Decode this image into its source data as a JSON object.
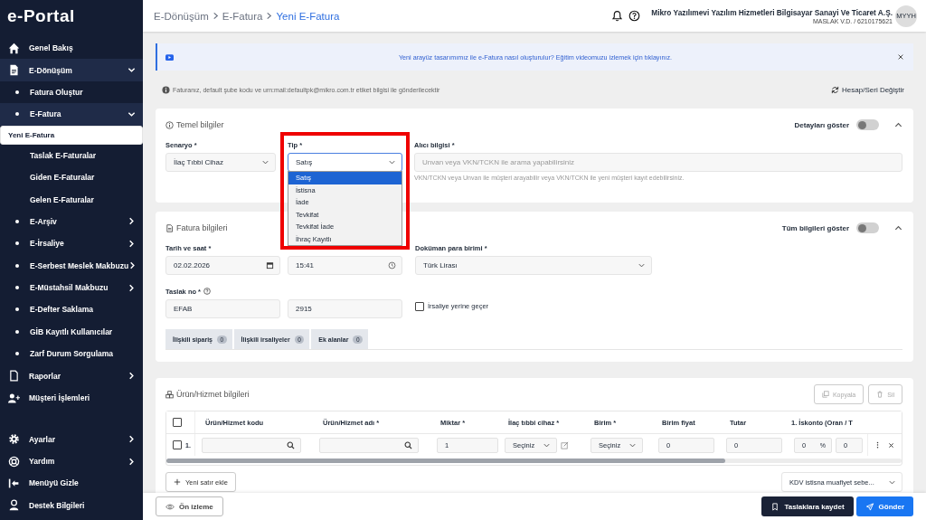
{
  "sidebar": {
    "logo": "e-Portal",
    "items": [
      {
        "label": "Genel Bakış",
        "kind": "link",
        "selected": false
      },
      {
        "label": "E-Dönüşüm",
        "kind": "group",
        "expanded": true,
        "selected": false,
        "children": [
          {
            "label": "Fatura Oluştur",
            "kind": "link",
            "selected": false
          },
          {
            "label": "E-Fatura",
            "kind": "group",
            "expanded": true,
            "selected": false,
            "children": [
              {
                "label": "Yeni E-Fatura",
                "selected": true
              },
              {
                "label": "Taslak E-Faturalar",
                "selected": false
              },
              {
                "label": "Giden E-Faturalar",
                "selected": false
              },
              {
                "label": "Gelen E-Faturalar",
                "selected": false
              }
            ]
          },
          {
            "label": "E-Arşiv",
            "kind": "group",
            "expanded": false,
            "selected": false
          },
          {
            "label": "E-İrsaliye",
            "kind": "group",
            "expanded": false,
            "selected": false
          },
          {
            "label": "E-Serbest Meslek Makbuzu",
            "kind": "group",
            "expanded": false,
            "selected": false
          },
          {
            "label": "E-Müstahsil Makbuzu",
            "kind": "group",
            "expanded": false,
            "selected": false
          },
          {
            "label": "E-Defter Saklama",
            "kind": "link",
            "selected": false
          },
          {
            "label": "GİB Kayıtlı Kullanıcılar",
            "kind": "link",
            "selected": false
          },
          {
            "label": "Zarf Durum Sorgulama",
            "kind": "link",
            "selected": false
          }
        ]
      },
      {
        "label": "Raporlar",
        "kind": "group",
        "expanded": false,
        "selected": false
      },
      {
        "label": "Müşteri İşlemleri",
        "kind": "link",
        "selected": false
      }
    ],
    "footer_items": [
      {
        "label": "Ayarlar",
        "kind": "group",
        "expanded": false,
        "selected": false
      },
      {
        "label": "Yardım",
        "kind": "group",
        "expanded": false,
        "selected": false
      },
      {
        "label": "Menüyü Gizle",
        "kind": "link",
        "selected": false
      },
      {
        "label": "Destek Bilgileri",
        "kind": "link",
        "selected": false
      }
    ]
  },
  "header": {
    "breadcrumb": [
      {
        "label": "E-Dönüşüm",
        "current": false
      },
      {
        "label": "E-Fatura",
        "current": false
      },
      {
        "label": "Yeni E-Fatura",
        "current": true
      }
    ],
    "company": "Mikro Yazılımevi Yazılım Hizmetleri Bilgisayar Sanayi Ve Ticaret A.Ş.",
    "tax_info": "MASLAK V.D. / 6210175621",
    "avatar": "MYYH"
  },
  "banner": {
    "text": "Yeni arayüz tasarımımız ile e-Fatura nasıl oluşturulur? Eğitim videomuzu izlemek için tıklayınız."
  },
  "info_note": "Faturanız, default şube kodu ve urn:mail:defaultpk@mikro.com.tr etiket bilgisi ile gönderilecektir",
  "account_link": "Hesap/Seri Değiştir",
  "basic_info": {
    "title": "Temel bilgiler",
    "toggle": {
      "label": "Detayları göster",
      "on": false
    },
    "expanded": true,
    "scenario": {
      "label": "Senaryo *",
      "value": "İlaç Tıbbi Cihaz"
    },
    "type": {
      "label": "Tip *",
      "value": "Satış",
      "highlighted": true,
      "options": [
        {
          "label": "Satış",
          "selected": true
        },
        {
          "label": "İstisna",
          "selected": false
        },
        {
          "label": "İade",
          "selected": false
        },
        {
          "label": "Tevkifat",
          "selected": false
        },
        {
          "label": "Tevkifat İade",
          "selected": false
        },
        {
          "label": "İhraç Kayıtlı",
          "selected": false
        }
      ]
    },
    "recipient": {
      "label": "Alıcı bilgisi *",
      "placeholder": "Unvan veya VKN/TCKN ile arama yapabilirsiniz",
      "hint": "VKN/TCKN veya Unvan ile müşteri arayabilir veya VKN/TCKN ile yeni müşteri kayıt edebilirsiniz."
    }
  },
  "invoice_info": {
    "title": "Fatura bilgileri",
    "toggle": {
      "label": "Tüm bilgileri göster",
      "on": false
    },
    "expanded": true,
    "date_label": "Tarih ve saat *",
    "date": "02.02.2026",
    "time": "15:41",
    "currency_label": "Doküman para birimi *",
    "currency": "Türk Lirası",
    "draft_label": "Taslak no *",
    "draft_series": "EFAB",
    "draft_number": "2915",
    "waybill": {
      "label": "İrsaliye yerine geçer",
      "checked": false
    },
    "tabs": [
      {
        "label": "İlişkili sipariş",
        "count": "0",
        "selected": false
      },
      {
        "label": "İlişkili irsaliyeler",
        "count": "0",
        "selected": false
      },
      {
        "label": "Ek alanlar",
        "count": "0",
        "selected": false
      }
    ]
  },
  "products": {
    "title": "Ürün/Hizmet bilgileri",
    "actions": [
      {
        "label": "Kopyala",
        "disabled": true
      },
      {
        "label": "Sil",
        "disabled": true
      }
    ],
    "all_checked": false,
    "columns": [
      "Ürün/Hizmet kodu",
      "Ürün/Hizmet adı *",
      "Miktar *",
      "İlaç tıbbi cihaz *",
      "Birim *",
      "Birim fiyat",
      "Tutar",
      "1. İskonto (Oran / T"
    ],
    "rows": [
      {
        "number": "1.",
        "checked": false,
        "cells": [
          {
            "kind": "search"
          },
          {
            "kind": "search"
          },
          {
            "kind": "input",
            "value": "1"
          },
          {
            "kind": "select",
            "value": "Seçiniz",
            "editable": true
          },
          {
            "kind": "select",
            "value": "Seçiniz",
            "editable": false
          },
          {
            "kind": "input",
            "value": "0"
          },
          {
            "kind": "input",
            "value": "0"
          },
          {
            "kind": "discount",
            "value": "0",
            "unit": "%",
            "amount": "0"
          }
        ]
      }
    ],
    "add_row": "Yeni satır ekle",
    "vat_exemption": "KDV istisna muafiyet sebe..."
  },
  "footer": {
    "preview": "Ön izleme",
    "save_draft": "Taslaklara kaydet",
    "send": "Gönder"
  }
}
